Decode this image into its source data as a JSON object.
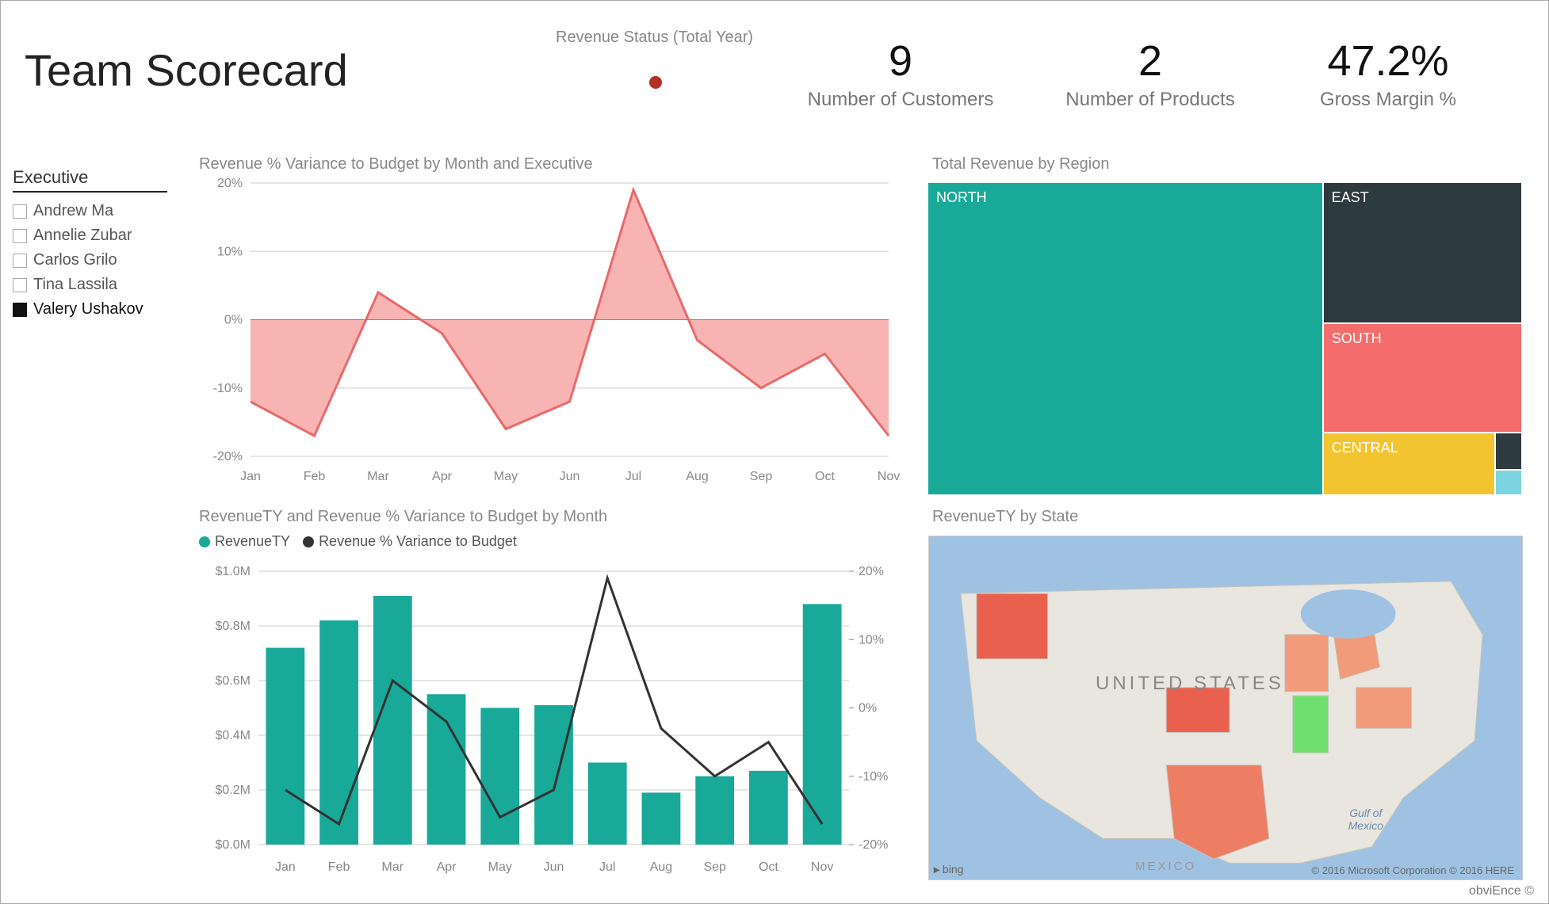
{
  "page_title": "Team Scorecard",
  "revenue_status": {
    "label": "Revenue Status (Total Year)",
    "color": "#b33022"
  },
  "kpis": [
    {
      "value": "9",
      "label": "Number of Customers"
    },
    {
      "value": "2",
      "label": "Number of Products"
    },
    {
      "value": "47.2%",
      "label": "Gross Margin %"
    }
  ],
  "slicer": {
    "title": "Executive",
    "items": [
      {
        "name": "Andrew Ma",
        "selected": false
      },
      {
        "name": "Annelie Zubar",
        "selected": false
      },
      {
        "name": "Carlos Grilo",
        "selected": false
      },
      {
        "name": "Tina Lassila",
        "selected": false
      },
      {
        "name": "Valery Ushakov",
        "selected": true
      }
    ]
  },
  "footer": "obviEnce ©",
  "map": {
    "title": "RevenueTY by State",
    "country_label": "UNITED STATES",
    "gulf_label": "Gulf of\nMexico",
    "mexico_label": "MEXICO",
    "bing": "bing",
    "copyright": "© 2016 Microsoft Corporation    © 2016 HERE",
    "highlighted": [
      "WA",
      "NE",
      "TX",
      "WI",
      "MI",
      "IL",
      "OH"
    ]
  },
  "treemap": {
    "title": "Total Revenue by Region",
    "cells": [
      {
        "name": "NORTH",
        "color": "#18a999"
      },
      {
        "name": "EAST",
        "color": "#2d3a3f"
      },
      {
        "name": "SOUTH",
        "color": "#f46c6c"
      },
      {
        "name": "CENTRAL",
        "color": "#f2c430"
      }
    ]
  },
  "chart_data": [
    {
      "id": "revenue_variance_area",
      "type": "area",
      "title": "Revenue % Variance to Budget by Month and Executive",
      "categories": [
        "Jan",
        "Feb",
        "Mar",
        "Apr",
        "May",
        "Jun",
        "Jul",
        "Aug",
        "Sep",
        "Oct",
        "Nov"
      ],
      "values": [
        -12,
        -17,
        4,
        -2,
        -16,
        -12,
        19,
        -3,
        -10,
        -5,
        -17
      ],
      "ylabel": "%",
      "ylim": [
        -20,
        20
      ],
      "yticks": [
        -20,
        -10,
        0,
        10,
        20
      ],
      "series_color": "#f8b3b3",
      "line_color": "#e86a6a"
    },
    {
      "id": "revenue_combo",
      "type": "combo",
      "title": "RevenueTY and Revenue % Variance to Budget by Month",
      "categories": [
        "Jan",
        "Feb",
        "Mar",
        "Apr",
        "May",
        "Jun",
        "Jul",
        "Aug",
        "Sep",
        "Oct",
        "Nov"
      ],
      "series": [
        {
          "name": "RevenueTY",
          "type": "bar",
          "axis": "left",
          "values": [
            0.72,
            0.82,
            0.91,
            0.55,
            0.5,
            0.51,
            0.3,
            0.19,
            0.25,
            0.27,
            0.88
          ],
          "color": "#18a999"
        },
        {
          "name": "Revenue % Variance to Budget",
          "type": "line",
          "axis": "right",
          "values": [
            -12,
            -17,
            4,
            -2,
            -16,
            -12,
            19,
            -3,
            -10,
            -5,
            -17
          ],
          "color": "#333"
        }
      ],
      "left_axis": {
        "label": "$M",
        "ticks": [
          0.0,
          0.2,
          0.4,
          0.6,
          0.8,
          1.0
        ],
        "tick_labels": [
          "$0.0M",
          "$0.2M",
          "$0.4M",
          "$0.6M",
          "$0.8M",
          "$1.0M"
        ]
      },
      "right_axis": {
        "label": "%",
        "ticks": [
          -20,
          -10,
          0,
          10,
          20
        ],
        "tick_labels": [
          "-20%",
          "-10%",
          "0%",
          "10%",
          "20%"
        ]
      },
      "legend": [
        "RevenueTY",
        "Revenue % Variance to Budget"
      ]
    },
    {
      "id": "region_treemap",
      "type": "treemap",
      "title": "Total Revenue by Region",
      "items": [
        {
          "name": "NORTH",
          "share": 0.56
        },
        {
          "name": "EAST",
          "share": 0.19
        },
        {
          "name": "SOUTH",
          "share": 0.14
        },
        {
          "name": "CENTRAL",
          "share": 0.09
        },
        {
          "name": "",
          "share": 0.014
        },
        {
          "name": "",
          "share": 0.006
        }
      ]
    }
  ]
}
